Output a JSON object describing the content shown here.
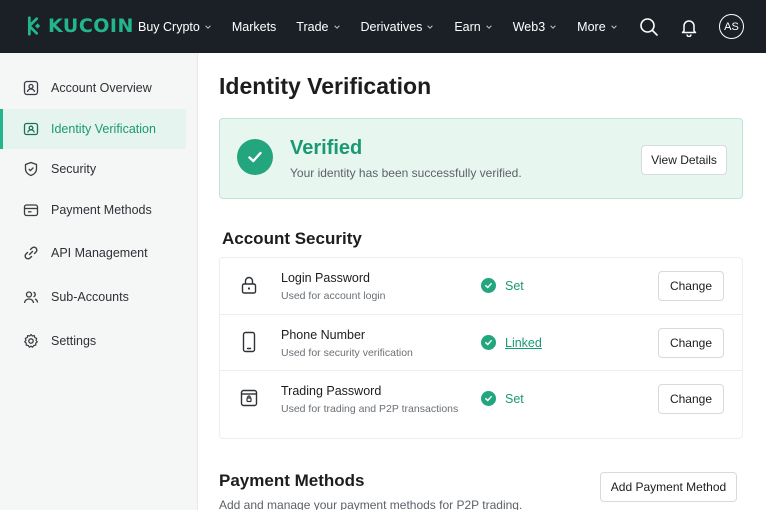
{
  "nav": {
    "logo_text": "KUCOIN",
    "items": [
      {
        "label": "Buy Crypto",
        "has_dropdown": true
      },
      {
        "label": "Markets",
        "has_dropdown": false
      },
      {
        "label": "Trade",
        "has_dropdown": true
      },
      {
        "label": "Derivatives",
        "has_dropdown": true
      },
      {
        "label": "Earn",
        "has_dropdown": true
      },
      {
        "label": "Web3",
        "has_dropdown": true
      },
      {
        "label": "More",
        "has_dropdown": true
      }
    ],
    "avatar_initials": "AS",
    "icons": [
      "search-icon",
      "bell-icon"
    ]
  },
  "sidebar": {
    "items": [
      {
        "label": "Account Overview",
        "icon": "user-card-icon",
        "active": false
      },
      {
        "label": "Identity Verification",
        "icon": "id-card-icon",
        "active": true
      },
      {
        "label": "Security",
        "icon": "shield-icon",
        "active": false
      },
      {
        "label": "Payment Methods",
        "icon": "wallet-icon",
        "active": false
      },
      {
        "label": "API Management",
        "icon": "link-icon",
        "active": false
      },
      {
        "label": "Sub-Accounts",
        "icon": "users-icon",
        "active": false
      },
      {
        "label": "Settings",
        "icon": "gear-icon",
        "active": false
      }
    ]
  },
  "main": {
    "title": "Identity Verification",
    "verified": {
      "title": "Verified",
      "subtitle": "Your identity has been successfully verified.",
      "button": "View Details"
    },
    "account_security": {
      "title": "Account Security",
      "rows": [
        {
          "title": "Login Password",
          "desc": "Used for account login",
          "status": "Set",
          "status_link": false,
          "button": "Change",
          "icon": "lock-icon"
        },
        {
          "title": "Phone Number",
          "desc": "Used for security verification",
          "status": "Linked",
          "status_link": true,
          "button": "Change",
          "icon": "phone-icon"
        },
        {
          "title": "Trading Password",
          "desc": "Used for trading and P2P transactions",
          "status": "Set",
          "status_link": false,
          "button": "Change",
          "icon": "trade-lock-icon"
        }
      ]
    },
    "payment_methods": {
      "title": "Payment Methods",
      "subtitle": "Add and manage your payment methods for P2P trading.",
      "button": "Add Payment Method"
    }
  },
  "colors": {
    "accent": "#23b68a",
    "nav_bg": "#1b2027",
    "success_bg": "#e8f6f0"
  }
}
